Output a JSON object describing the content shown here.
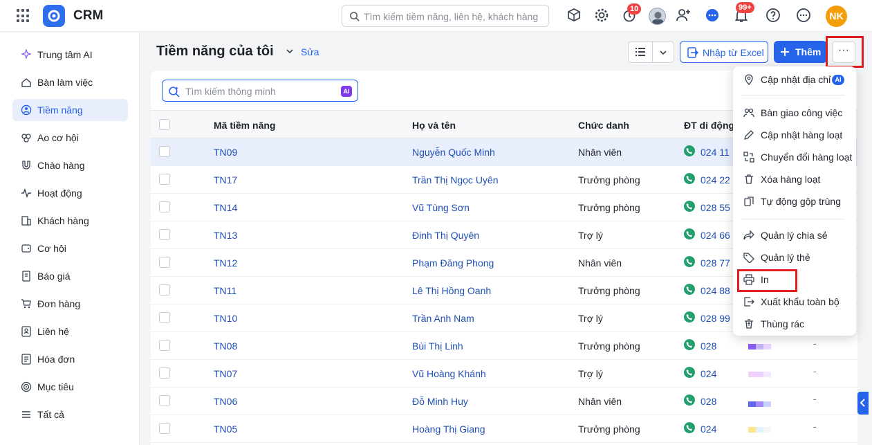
{
  "app": {
    "title": "CRM",
    "search_placeholder": "Tìm kiếm tiềm năng, liên hệ, khách hàng",
    "badges": {
      "timer": "10",
      "notifications": "99+"
    },
    "user_initials": "NK"
  },
  "sidebar": {
    "items": [
      {
        "label": "Trung tâm AI",
        "icon": "sparkle-icon"
      },
      {
        "label": "Bàn làm việc",
        "icon": "home-icon"
      },
      {
        "label": "Tiềm năng",
        "icon": "lead-icon",
        "active": true
      },
      {
        "label": "Ao cơ hội",
        "icon": "pool-icon"
      },
      {
        "label": "Chào hàng",
        "icon": "magnet-icon"
      },
      {
        "label": "Hoạt động",
        "icon": "activity-icon"
      },
      {
        "label": "Khách hàng",
        "icon": "building-icon"
      },
      {
        "label": "Cơ hội",
        "icon": "wallet-icon"
      },
      {
        "label": "Báo giá",
        "icon": "quote-icon"
      },
      {
        "label": "Đơn hàng",
        "icon": "cart-icon"
      },
      {
        "label": "Liên hệ",
        "icon": "contact-icon"
      },
      {
        "label": "Hóa đơn",
        "icon": "invoice-icon"
      },
      {
        "label": "Mục tiêu",
        "icon": "target-icon"
      },
      {
        "label": "Tất cả",
        "icon": "menu-icon"
      }
    ]
  },
  "header": {
    "title": "Tiềm năng của tôi",
    "edit": "Sửa",
    "import_excel": "Nhập từ Excel",
    "add": "Thêm",
    "more": "···"
  },
  "table": {
    "smart_search_placeholder": "Tìm kiếm thông minh",
    "ai_label": "AI",
    "columns": [
      "Mã tiềm năng",
      "Họ và tên",
      "Chức danh",
      "ĐT di động"
    ],
    "rows": [
      {
        "code": "TN09",
        "name": "Nguyễn Quốc Minh",
        "title": "Nhân viên",
        "phone": "024 11",
        "extra": ""
      },
      {
        "code": "TN17",
        "name": "Trần Thị Ngọc Uyên",
        "title": "Trưởng phòng",
        "phone": "024 22",
        "extra": ""
      },
      {
        "code": "TN14",
        "name": "Vũ Tùng Sơn",
        "title": "Trưởng phòng",
        "phone": "028 55",
        "extra": ""
      },
      {
        "code": "TN13",
        "name": "Đinh Thị Quyên",
        "title": "Trợ lý",
        "phone": "024 66",
        "extra": ""
      },
      {
        "code": "TN12",
        "name": "Phạm Đăng Phong",
        "title": "Nhân viên",
        "phone": "028 77",
        "extra": ""
      },
      {
        "code": "TN11",
        "name": "Lê Thị Hồng Oanh",
        "title": "Trưởng phòng",
        "phone": "024 88",
        "extra": ""
      },
      {
        "code": "TN10",
        "name": "Trần Anh Nam",
        "title": "Trợ lý",
        "phone": "028 99",
        "extra": ""
      },
      {
        "code": "TN08",
        "name": "Bùi Thị Linh",
        "title": "Trưởng phòng",
        "phone": "028",
        "extra": "-"
      },
      {
        "code": "TN07",
        "name": "Vũ Hoàng Khánh",
        "title": "Trợ lý",
        "phone": "024",
        "extra": "-"
      },
      {
        "code": "TN06",
        "name": "Đỗ Minh Huy",
        "title": "Nhân viên",
        "phone": "028",
        "extra": "-"
      },
      {
        "code": "TN05",
        "name": "Hoàng Thị Giang",
        "title": "Trưởng phòng",
        "phone": "024",
        "extra": "-"
      }
    ]
  },
  "dropdown": {
    "items": [
      {
        "label": "Cập nhật địa chỉ",
        "icon": "map-pin-icon",
        "ai": "AI"
      },
      {
        "label": "Bàn giao công việc",
        "icon": "handover-icon"
      },
      {
        "label": "Cập nhật hàng loạt",
        "icon": "pencil-icon"
      },
      {
        "label": "Chuyển đổi hàng loạt",
        "icon": "convert-icon"
      },
      {
        "label": "Xóa hàng loạt",
        "icon": "trash-icon"
      },
      {
        "label": "Tự động gộp trùng",
        "icon": "merge-icon"
      },
      {
        "label": "Quản lý chia sẻ",
        "icon": "share-icon"
      },
      {
        "label": "Quản lý thẻ",
        "icon": "tag-icon"
      },
      {
        "label": "In",
        "icon": "printer-icon"
      },
      {
        "label": "Xuất khẩu toàn bộ",
        "icon": "export-icon"
      },
      {
        "label": "Thùng rác",
        "icon": "recycle-bin-icon"
      }
    ]
  },
  "colors": {
    "primary": "#2563eb",
    "highlight": "#e11d1d",
    "selected_row": "#e8eefc",
    "phone_green": "#22a06b"
  }
}
